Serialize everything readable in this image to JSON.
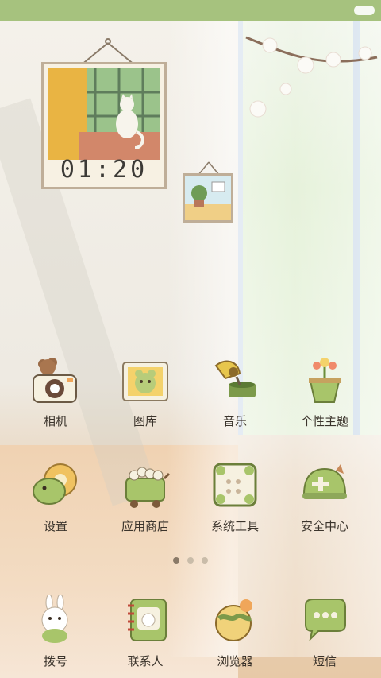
{
  "status_bar": {
    "battery_icon": "battery-icon",
    "color": "#a6c27e"
  },
  "clock": {
    "time": "01:20"
  },
  "apps": [
    {
      "label": "相机",
      "icon": "camera-icon"
    },
    {
      "label": "图库",
      "icon": "gallery-icon"
    },
    {
      "label": "音乐",
      "icon": "music-icon"
    },
    {
      "label": "个性主题",
      "icon": "theme-icon"
    },
    {
      "label": "设置",
      "icon": "settings-icon"
    },
    {
      "label": "应用商店",
      "icon": "app-store-icon"
    },
    {
      "label": "系统工具",
      "icon": "system-tools-icon"
    },
    {
      "label": "安全中心",
      "icon": "security-center-icon"
    },
    {
      "label": "拨号",
      "icon": "dialer-icon"
    },
    {
      "label": "联系人",
      "icon": "contacts-icon"
    },
    {
      "label": "浏览器",
      "icon": "browser-icon"
    },
    {
      "label": "短信",
      "icon": "messages-icon"
    }
  ],
  "page_indicator": {
    "pages": 3,
    "current": 1
  }
}
